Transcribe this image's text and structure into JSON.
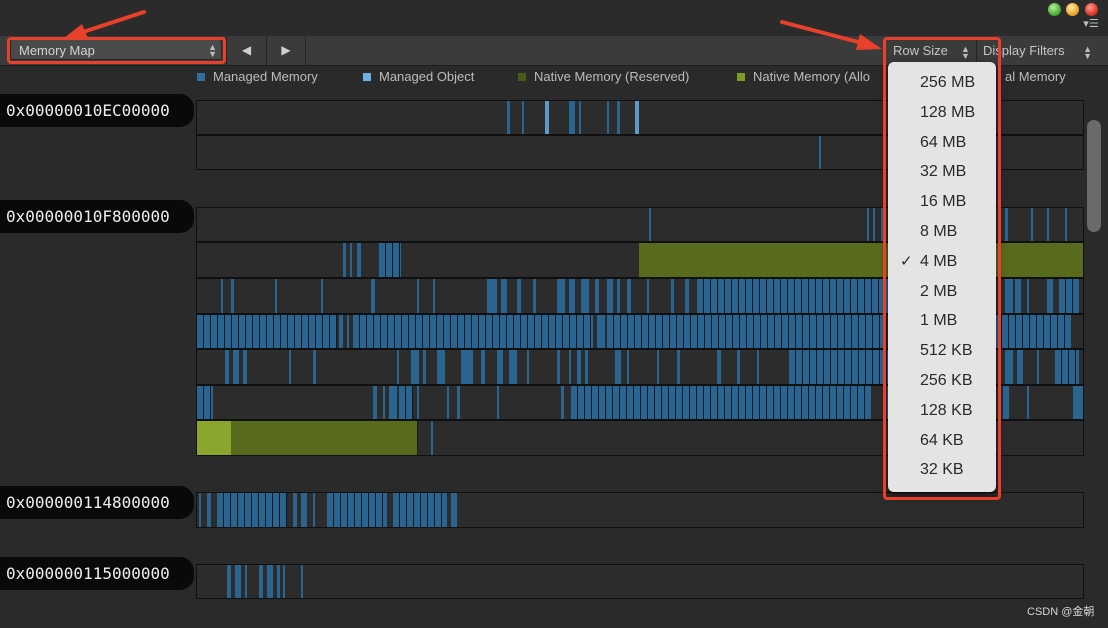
{
  "toolbar": {
    "view_selector": "Memory Map",
    "nav_back_icon": "◀",
    "nav_forward_icon": "▶",
    "row_size_label": "Row Size",
    "display_filters_label": "Display Filters"
  },
  "legend": [
    {
      "label": "Managed Memory",
      "color": "#2f6f9e"
    },
    {
      "label": "Managed Object",
      "color": "#6cb0e2"
    },
    {
      "label": "Native Memory (Reserved)",
      "color": "#4a5a1a"
    },
    {
      "label": "Native Memory (Allo",
      "color": "#7e9b24"
    },
    {
      "label": "al Memory",
      "color": "#2f6f9e"
    }
  ],
  "colors": {
    "managed_memory": "#2a6592",
    "managed_object": "#5a9cc9",
    "native_reserved": "#586b1c",
    "native_allocated": "#8aa62c",
    "annotation": "#e8402a"
  },
  "regions": [
    {
      "address": "0x00000010EC00000"
    },
    {
      "address": "0x00000010F800000"
    },
    {
      "address": "0x000000114800000"
    },
    {
      "address": "0x000000115000000"
    }
  ],
  "row_size_menu": {
    "selected": "4 MB",
    "check_mark": "✓",
    "options": [
      "256 MB",
      "128 MB",
      "64 MB",
      "32 MB",
      "16 MB",
      "8 MB",
      "4 MB",
      "2 MB",
      "1 MB",
      "512 KB",
      "256 KB",
      "128 KB",
      "64 KB",
      "32 KB"
    ]
  },
  "watermark": "CSDN @金朝"
}
